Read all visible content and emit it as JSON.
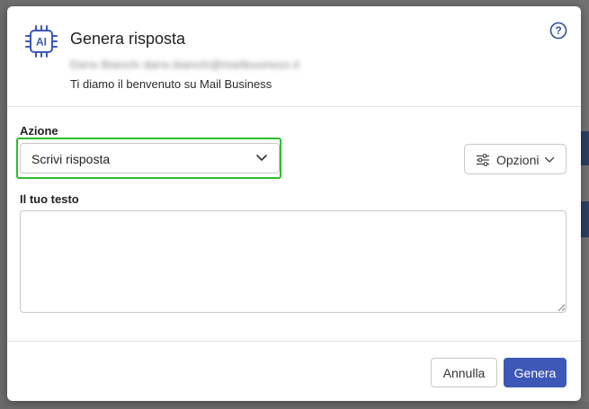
{
  "dialog": {
    "title": "Genera risposta",
    "ai_icon_label": "AI",
    "from_line": "Dario Bianchi dario.bianchi@mailbusiness.it",
    "subject": "Ti diamo il benvenuto su Mail Business"
  },
  "form": {
    "action_label": "Azione",
    "action_value": "Scrivi risposta",
    "options_label": "Opzioni",
    "text_label": "Il tuo testo",
    "text_value": ""
  },
  "footer": {
    "cancel_label": "Annulla",
    "submit_label": "Genera"
  },
  "colors": {
    "primary": "#3d58b6",
    "highlight": "#2ebd2e",
    "help_icon": "#2f4f9e"
  }
}
